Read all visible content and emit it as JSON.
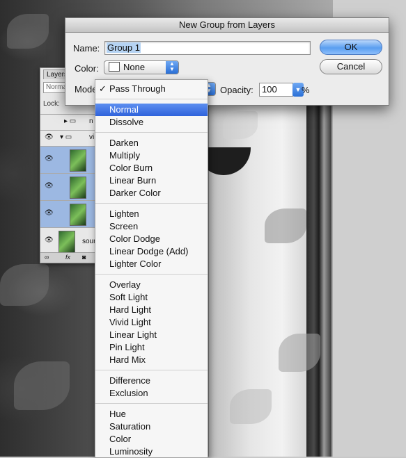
{
  "dialog": {
    "title": "New Group from Layers",
    "name_label": "Name:",
    "name_value": "Group 1",
    "color_label": "Color:",
    "color_value": "None",
    "mode_label": "Mode:",
    "opacity_label": "Opacity:",
    "opacity_value": "100",
    "opacity_unit": "%",
    "ok_label": "OK",
    "cancel_label": "Cancel"
  },
  "mode_menu": {
    "selected": "Pass Through",
    "highlighted": "Normal",
    "groups": [
      [
        "Pass Through"
      ],
      [
        "Normal",
        "Dissolve"
      ],
      [
        "Darken",
        "Multiply",
        "Color Burn",
        "Linear Burn",
        "Darker Color"
      ],
      [
        "Lighten",
        "Screen",
        "Color Dodge",
        "Linear Dodge (Add)",
        "Lighter Color"
      ],
      [
        "Overlay",
        "Soft Light",
        "Hard Light",
        "Vivid Light",
        "Linear Light",
        "Pin Light",
        "Hard Mix"
      ],
      [
        "Difference",
        "Exclusion"
      ],
      [
        "Hue",
        "Saturation",
        "Color",
        "Luminosity"
      ]
    ]
  },
  "layers_panel": {
    "tab_label": "Layers",
    "blend_value": "Normal",
    "lock_label": "Lock:",
    "rows": [
      {
        "name": "n"
      },
      {
        "name": "vi"
      },
      {
        "name": ""
      },
      {
        "name": ""
      },
      {
        "name": ""
      },
      {
        "name": "sour"
      }
    ],
    "fx_label": "fx"
  }
}
